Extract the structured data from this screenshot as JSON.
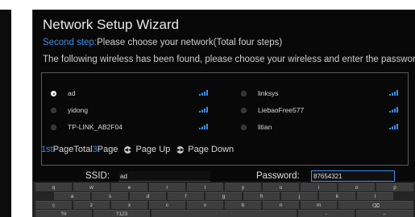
{
  "wizard": {
    "title": "Network Setup Wizard",
    "step_highlight": "Second step:",
    "step_text": "Please choose your network(Total four steps)",
    "instruction": "The following wireless has been found, please choose your wireless and enter the password"
  },
  "networks": [
    {
      "name": "ad",
      "selected": true
    },
    {
      "name": "linksys",
      "selected": false
    },
    {
      "name": "yidong",
      "selected": false
    },
    {
      "name": "LiebaoFree577",
      "selected": false
    },
    {
      "name": "TP-LINK_AB2F04",
      "selected": false
    },
    {
      "name": "litian",
      "selected": false
    }
  ],
  "pager": {
    "current": "1st",
    "page_word": "Page",
    "total_word": "Total",
    "total": "3",
    "page_word2": "Page",
    "page_up": "Page Up",
    "page_down": "Page Down"
  },
  "form": {
    "ssid_label": "SSID:",
    "ssid_value": "ad",
    "password_label": "Password:",
    "password_value": "87654321"
  },
  "keyboard": {
    "row1": [
      "q",
      "w",
      "e",
      "r",
      "t",
      "y",
      "u",
      "i",
      "o",
      "p"
    ],
    "row2": [
      "a",
      "s",
      "d",
      "f",
      "g",
      "h",
      "j",
      "k",
      "l"
    ],
    "row3": [
      "⇧",
      "z",
      "x",
      "c",
      "v",
      "b",
      "n",
      "m",
      "⌫"
    ],
    "row4": [
      "?#",
      "?123",
      "",
      "-",
      "←"
    ]
  },
  "colors": {
    "accent": "#3a8ee6",
    "background": "#080808"
  }
}
